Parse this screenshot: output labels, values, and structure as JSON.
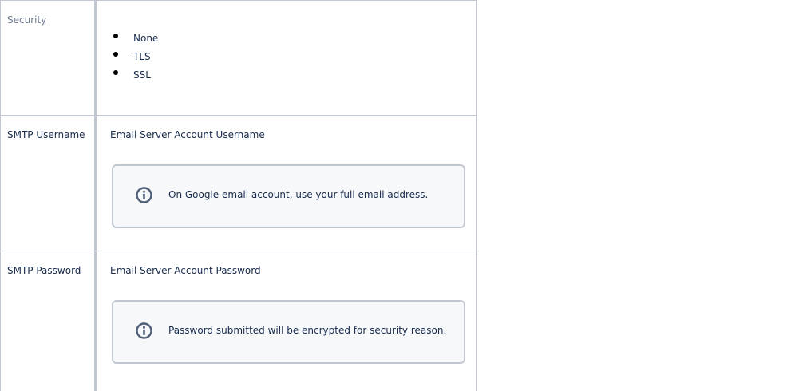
{
  "rows": [
    {
      "label": "Security",
      "options": [
        "None",
        "TLS",
        "SSL"
      ]
    },
    {
      "label": "SMTP Username",
      "description": "Email Server Account Username",
      "info": {
        "icon": "info-icon",
        "text": "On Google email account, use your full email address."
      }
    },
    {
      "label": "SMTP Password",
      "description": "Email Server Account Password",
      "info": {
        "icon": "info-icon",
        "text": "Password submitted will be encrypted for security reason."
      }
    }
  ],
  "colors": {
    "border": "#c1c7d0",
    "text": "#172b4d",
    "muted_label": "#6b778c",
    "panel_bg": "#f7f8fa",
    "icon": "#505f79"
  }
}
